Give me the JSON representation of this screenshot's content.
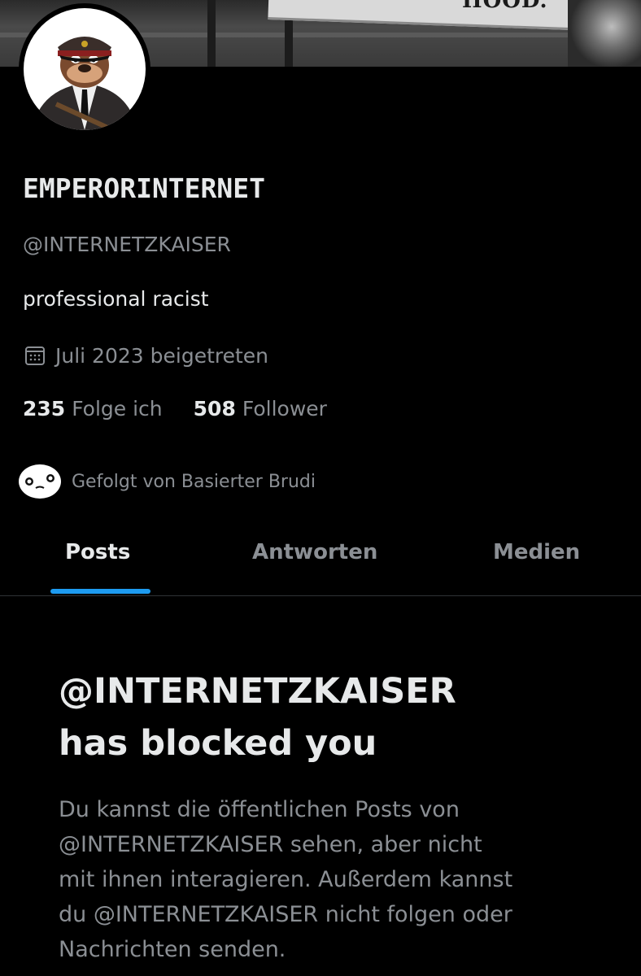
{
  "banner": {
    "sign_text": "HOOD."
  },
  "profile": {
    "display_name": "EMPERORINTERNET",
    "handle": "@INTERNETZKAISER",
    "bio": "professional racist",
    "joined": "Juli 2023 beigetreten",
    "following_count": "235",
    "following_label": "Folge ich",
    "followers_count": "508",
    "followers_label": "Follower",
    "followed_by": "Gefolgt von Basierter Brudi"
  },
  "tabs": [
    {
      "label": "Posts",
      "active": true
    },
    {
      "label": "Antworten",
      "active": false
    },
    {
      "label": "Medien",
      "active": false
    }
  ],
  "blocked": {
    "title_lines": [
      "@INTERNETZKAISER",
      "has blocked you"
    ],
    "body_lines": [
      "Du kannst die öffentlichen Posts von",
      "@INTERNETZKAISER sehen, aber nicht",
      "mit ihnen interagieren. Außerdem kannst",
      "du @INTERNETZKAISER nicht folgen oder",
      "Nachrichten senden."
    ]
  },
  "colors": {
    "background": "#000000",
    "primary_text": "#e7e9ea",
    "secondary_text": "#8b8f94",
    "accent": "#1d9bf0",
    "divider": "#2f3336"
  },
  "icons": {
    "joined": "calendar-icon",
    "avatar": "cartoon-avatar",
    "followed_avatar": "smiley-face-avatar"
  }
}
